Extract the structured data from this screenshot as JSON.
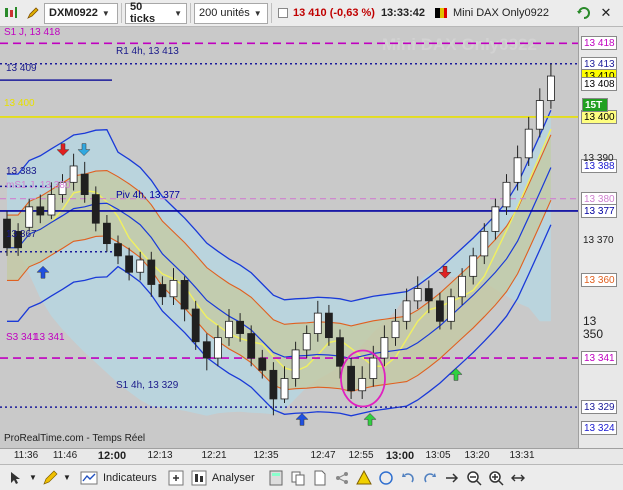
{
  "toolbar": {
    "instrument": "DXM0922",
    "ticks": "50 ticks",
    "units": "200 unités",
    "price_change": "13 410 (-0,63 %)",
    "time": "13:33:42",
    "title": "Mini DAX Only0922",
    "close": "✕"
  },
  "chart": {
    "watermark": "Mini DAX Only0922",
    "credit": "ProRealTime.com - Temps Réel",
    "levels": {
      "s1_j": "S1 J, 13 418",
      "r1_4h": "R1 4h, 13 413",
      "lvl_13409": "13 409",
      "lvl_13400": "13 400",
      "lvl_13383": "13 383",
      "lvl_ms_j": "mS1 J, 13 380",
      "piv_4h": "Piv 4h, 13 377",
      "lvl_13367": "13 367",
      "s3_341": "S3 341",
      "lvl_13341": "13 341",
      "s1_4h": "S1 4h, 13 329"
    },
    "price_axis": {
      "tags": [
        {
          "text": "13 418",
          "bg": "#ffffff",
          "fg": "#c000c0"
        },
        {
          "text": "13 413",
          "bg": "#ffffff",
          "fg": "#1a1a9a"
        },
        {
          "text": "13 410",
          "bg": "#ffff00",
          "fg": "#000000"
        },
        {
          "text": "13 408",
          "bg": "#ffffff",
          "fg": "#000000"
        },
        {
          "text": "13 400",
          "bg": "#ffff80",
          "fg": "#000000"
        },
        {
          "text": "13 388",
          "bg": "#ffffff",
          "fg": "#1a1ad0"
        },
        {
          "text": "13 380",
          "bg": "#ffffff",
          "fg": "#d080d0"
        },
        {
          "text": "13 377",
          "bg": "#ffffff",
          "fg": "#0000a0"
        },
        {
          "text": "13 360",
          "bg": "#ffffff",
          "fg": "#e06020"
        },
        {
          "text": "13 341",
          "bg": "#ffffff",
          "fg": "#c000c0"
        },
        {
          "text": "13 329",
          "bg": "#ffffff",
          "fg": "#1a1a9a"
        },
        {
          "text": "13 324",
          "bg": "#ffffff",
          "fg": "#1a1ad0"
        }
      ],
      "grid_labels": [
        "13 390",
        "13 370",
        "13 350"
      ],
      "tick_badge": "15T"
    },
    "time_axis": [
      "11:36",
      "11:46",
      "12:00",
      "12:13",
      "12:21",
      "12:35",
      "12:47",
      "12:55",
      "13:00",
      "13:05",
      "13:20",
      "13:31"
    ]
  },
  "bottom_toolbar": {
    "indicators": "Indicateurs",
    "analyse": "Analyser"
  },
  "chart_data": {
    "type": "candlestick",
    "y_unit": "price",
    "ylim": [
      13319,
      13422
    ],
    "candles": [
      [
        13375,
        13368,
        13377,
        13366
      ],
      [
        13372,
        13368,
        13374,
        13366
      ],
      [
        13373,
        13378,
        13380,
        13372
      ],
      [
        13378,
        13376,
        13381,
        13374
      ],
      [
        13376,
        13381,
        13384,
        13375
      ],
      [
        13381,
        13384,
        13386,
        13379
      ],
      [
        13384,
        13388,
        13391,
        13382
      ],
      [
        13386,
        13381,
        13389,
        13379
      ],
      [
        13381,
        13374,
        13383,
        13372
      ],
      [
        13374,
        13369,
        13376,
        13367
      ],
      [
        13369,
        13366,
        13371,
        13364
      ],
      [
        13366,
        13362,
        13368,
        13360
      ],
      [
        13362,
        13365,
        13367,
        13360
      ],
      [
        13365,
        13359,
        13367,
        13356
      ],
      [
        13359,
        13356,
        13361,
        13354
      ],
      [
        13356,
        13360,
        13363,
        13354
      ],
      [
        13360,
        13353,
        13361,
        13350
      ],
      [
        13353,
        13345,
        13355,
        13343
      ],
      [
        13345,
        13341,
        13347,
        13338
      ],
      [
        13341,
        13346,
        13349,
        13339
      ],
      [
        13346,
        13350,
        13353,
        13344
      ],
      [
        13350,
        13347,
        13352,
        13345
      ],
      [
        13347,
        13341,
        13349,
        13339
      ],
      [
        13341,
        13338,
        13343,
        13336
      ],
      [
        13338,
        13331,
        13340,
        13327
      ],
      [
        13331,
        13336,
        13339,
        13330
      ],
      [
        13336,
        13343,
        13345,
        13334
      ],
      [
        13343,
        13347,
        13349,
        13341
      ],
      [
        13347,
        13352,
        13355,
        13345
      ],
      [
        13352,
        13346,
        13354,
        13344
      ],
      [
        13346,
        13339,
        13348,
        13336
      ],
      [
        13339,
        13333,
        13341,
        13331
      ],
      [
        13333,
        13336,
        13339,
        13331
      ],
      [
        13336,
        13341,
        13344,
        13334
      ],
      [
        13341,
        13346,
        13349,
        13339
      ],
      [
        13346,
        13350,
        13353,
        13344
      ],
      [
        13350,
        13355,
        13358,
        13348
      ],
      [
        13355,
        13358,
        13361,
        13353
      ],
      [
        13358,
        13355,
        13360,
        13352
      ],
      [
        13355,
        13350,
        13357,
        13348
      ],
      [
        13350,
        13356,
        13358,
        13348
      ],
      [
        13356,
        13361,
        13363,
        13354
      ],
      [
        13361,
        13366,
        13368,
        13359
      ],
      [
        13366,
        13372,
        13374,
        13364
      ],
      [
        13372,
        13378,
        13380,
        13370
      ],
      [
        13378,
        13384,
        13386,
        13376
      ],
      [
        13384,
        13390,
        13393,
        13382
      ],
      [
        13390,
        13397,
        13400,
        13388
      ],
      [
        13397,
        13404,
        13407,
        13395
      ],
      [
        13404,
        13410,
        13413,
        13402
      ]
    ]
  }
}
